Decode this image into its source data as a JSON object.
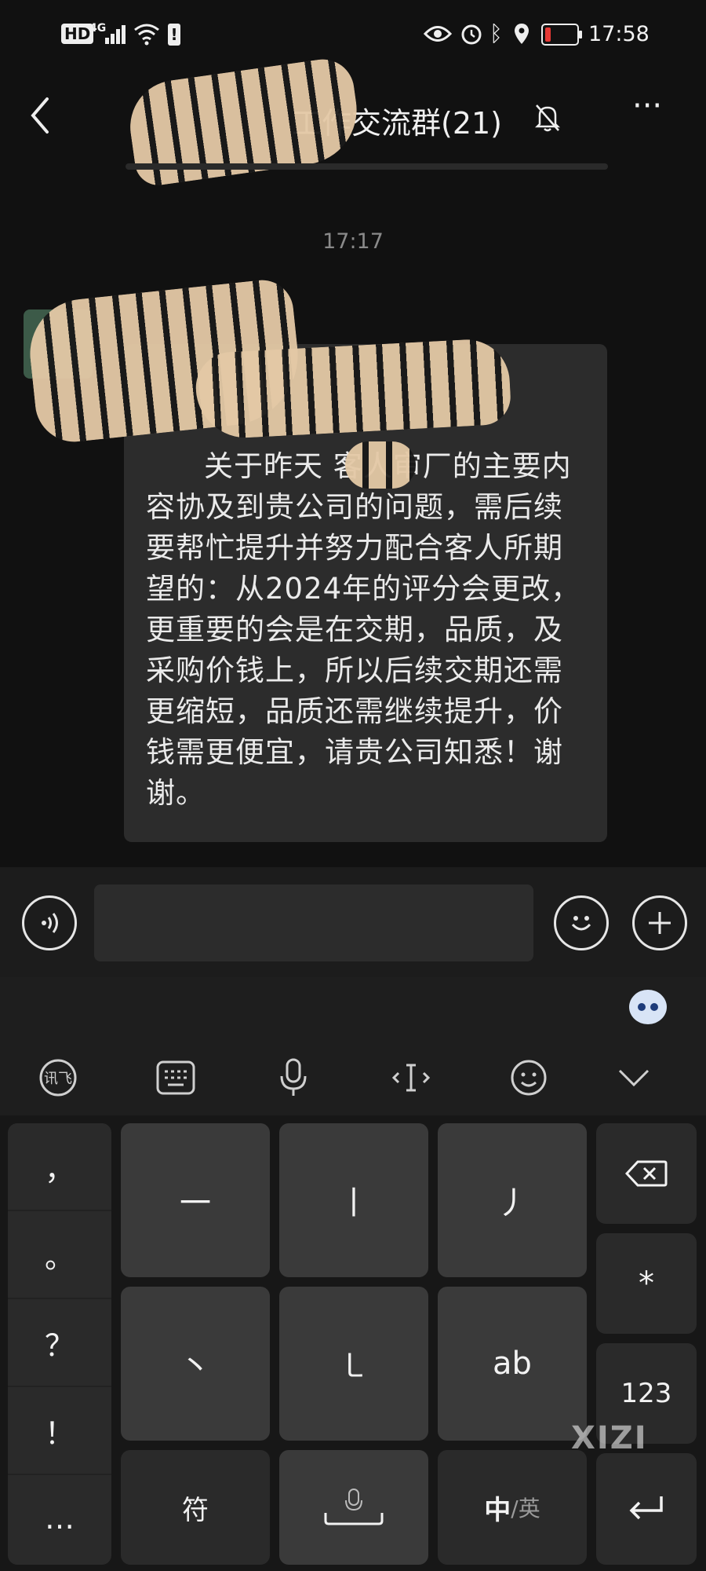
{
  "status_bar": {
    "hd": "HD",
    "network": "4G",
    "time": "17:58"
  },
  "header": {
    "title": "工作交流群(21)"
  },
  "chat": {
    "time_separator": "17:17",
    "message_text": "关于昨天 客人审厂的主要内容协及到贵公司的问题，需后续要帮忙提升并努力配合客人所期望的：从2024年的评分会更改，更重要的会是在交期，品质，及采购价钱上，所以后续交期还需更缩短，品质还需继续提升，价钱需更便宜，请贵公司知悉！谢谢。"
  },
  "input_bar": {
    "value": ""
  },
  "keyboard": {
    "punctuation": [
      "，",
      "。",
      "？",
      "！",
      "…"
    ],
    "keys": {
      "k1": "一",
      "k2": "丨",
      "k3": "丿",
      "k4": "丶",
      "k5": "㇄",
      "k6": "ab",
      "star": "*",
      "num": "123",
      "symbols": "符",
      "lang_main": "中",
      "lang_alt": "/英"
    }
  },
  "watermark": "XIZI"
}
